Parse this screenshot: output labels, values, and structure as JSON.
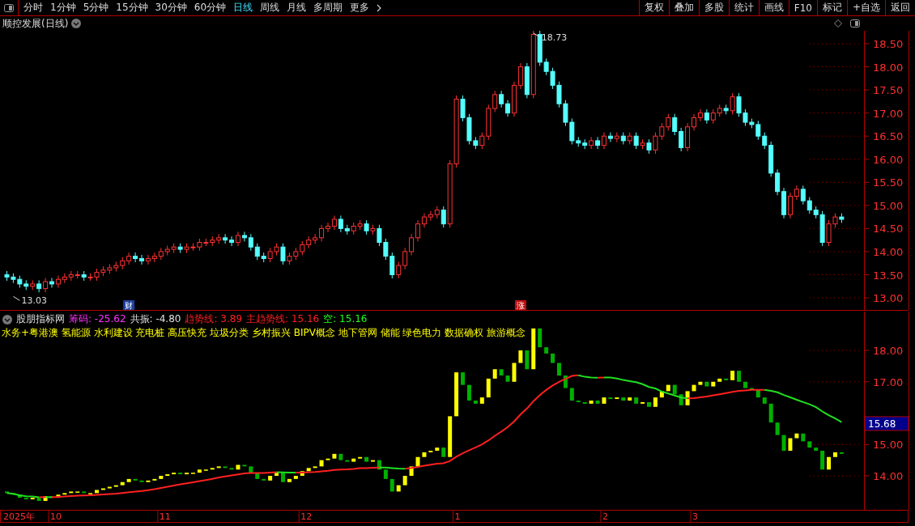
{
  "toolbar": {
    "periods": [
      {
        "label": "分时",
        "selected": false
      },
      {
        "label": "1分钟",
        "selected": false
      },
      {
        "label": "5分钟",
        "selected": false
      },
      {
        "label": "15分钟",
        "selected": false
      },
      {
        "label": "30分钟",
        "selected": false
      },
      {
        "label": "60分钟",
        "selected": false
      },
      {
        "label": "日线",
        "selected": true
      },
      {
        "label": "周线",
        "selected": false
      },
      {
        "label": "月线",
        "selected": false
      },
      {
        "label": "多周期",
        "selected": false
      },
      {
        "label": "更多",
        "selected": false
      }
    ],
    "actions": [
      "复权",
      "叠加",
      "多股",
      "统计",
      "画线",
      "F10",
      "标记",
      "+自选",
      "返回"
    ]
  },
  "main_chart": {
    "title": "顺控发展(日线)",
    "y_axis": [
      "18.50",
      "18.00",
      "17.50",
      "17.00",
      "16.50",
      "16.00",
      "15.50",
      "15.00",
      "14.50",
      "14.00",
      "13.50",
      "13.00"
    ],
    "high_label": "18.73",
    "low_label": "13.03",
    "events": [
      {
        "label": "财",
        "color": "#1c3f9e"
      },
      {
        "label": "涨",
        "color": "#c01010"
      }
    ]
  },
  "indicator": {
    "title": "股朋指标网",
    "readings": [
      {
        "text": "筹码: -25.62",
        "color": "#ff32ff"
      },
      {
        "text": "共振: -4.80",
        "color": "#e0e0e0"
      },
      {
        "text": "趋势线: 3.89",
        "color": "#ff2020"
      },
      {
        "text": "主趋势线: 15.16",
        "color": "#ff2020"
      },
      {
        "text": "空: 15.16",
        "color": "#20ff20"
      }
    ],
    "concepts": "水务+粤港澳 氢能源 水利建设 充电桩 高压快充 垃圾分类 乡村振兴 BIPV概念 地下管网 储能 绿色电力 数据确权 旅游概念",
    "y_axis": [
      "18.00",
      "17.00",
      "15.00",
      "14.00"
    ],
    "current_value": "15.68",
    "x_axis": [
      "2025年",
      "10",
      "11",
      "12",
      "1",
      "2",
      "3"
    ]
  }
}
